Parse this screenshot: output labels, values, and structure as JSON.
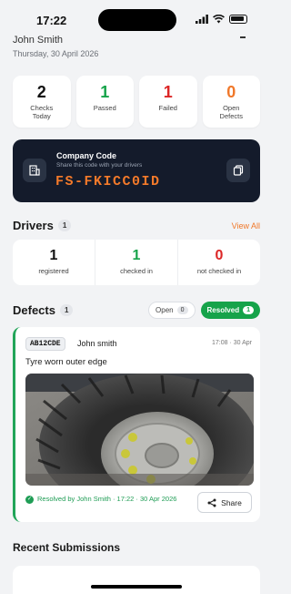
{
  "status_bar": {
    "time": "17:22"
  },
  "header": {
    "user": "John Smith",
    "date": "Thursday, 30 April 2026"
  },
  "stats": [
    {
      "value": "2",
      "label": "Checks Today",
      "color": "#111111"
    },
    {
      "value": "1",
      "label": "Passed",
      "color": "#16a34a"
    },
    {
      "value": "1",
      "label": "Failed",
      "color": "#dc2626"
    },
    {
      "value": "0",
      "label": "Open Defects",
      "color": "#f0782a"
    }
  ],
  "company": {
    "title": "Company Code",
    "subtitle": "Share this code with your drivers",
    "code": "FS-FKICC0ID",
    "building_icon": "building-icon",
    "copy_icon": "copy-icon"
  },
  "drivers": {
    "title": "Drivers",
    "count": "1",
    "view_all": "View All",
    "stats": [
      {
        "value": "1",
        "label": "registered",
        "color": "#111111"
      },
      {
        "value": "1",
        "label": "checked in",
        "color": "#16a34a"
      },
      {
        "value": "0",
        "label": "not checked in",
        "color": "#dc2626"
      }
    ]
  },
  "defects": {
    "title": "Defects",
    "count": "1",
    "tabs": {
      "open": {
        "label": "Open",
        "count": "0"
      },
      "resolved": {
        "label": "Resolved",
        "count": "1"
      }
    },
    "item": {
      "plate": "AB12CDE",
      "driver": "John smith",
      "time": "17:08 · 30 Apr",
      "description": "Tyre worn outer edge",
      "resolved_text": "Resolved by John Smith · 17:22 · 30 Apr 2026",
      "share_label": "Share"
    }
  },
  "recent": {
    "title": "Recent Submissions"
  }
}
